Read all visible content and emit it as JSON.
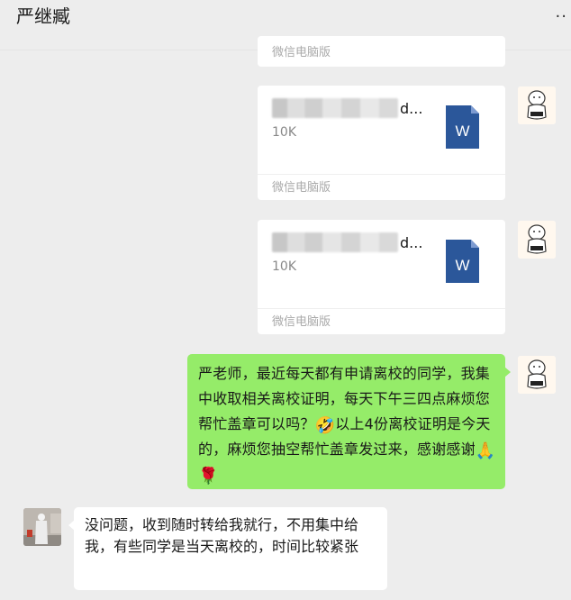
{
  "header": {
    "title": "严继臧",
    "more_icon": "more-icon"
  },
  "messages": {
    "top_card": {
      "source": "微信电脑版"
    },
    "file_1": {
      "name_suffix": "d...",
      "size": "10K",
      "source": "微信电脑版",
      "icon": "word-icon",
      "icon_letter": "W"
    },
    "file_2": {
      "name_suffix": "d...",
      "size": "10K",
      "source": "微信电脑版",
      "icon": "word-icon",
      "icon_letter": "W"
    },
    "outgoing": {
      "text_1": "严老师，最近每天都有申请离校的同学，我集中收取相关离校证明，每天下午三四点麻烦您帮忙盖章可以吗？",
      "emoji_1": "🤣",
      "text_2": "以上4份离校证明是今天的，麻烦您抽空帮忙盖章发过来，感谢感谢",
      "emoji_2": "🙏",
      "emoji_3": "🌹"
    },
    "incoming": {
      "text": "没问题，收到随时转给我就行，不用集中给我，有些同学是当天离校的，时间比较紧张"
    }
  },
  "colors": {
    "background": "#ededed",
    "outgoing_bubble": "#95ec69",
    "incoming_bubble": "#ffffff",
    "word_blue": "#2b579a"
  }
}
